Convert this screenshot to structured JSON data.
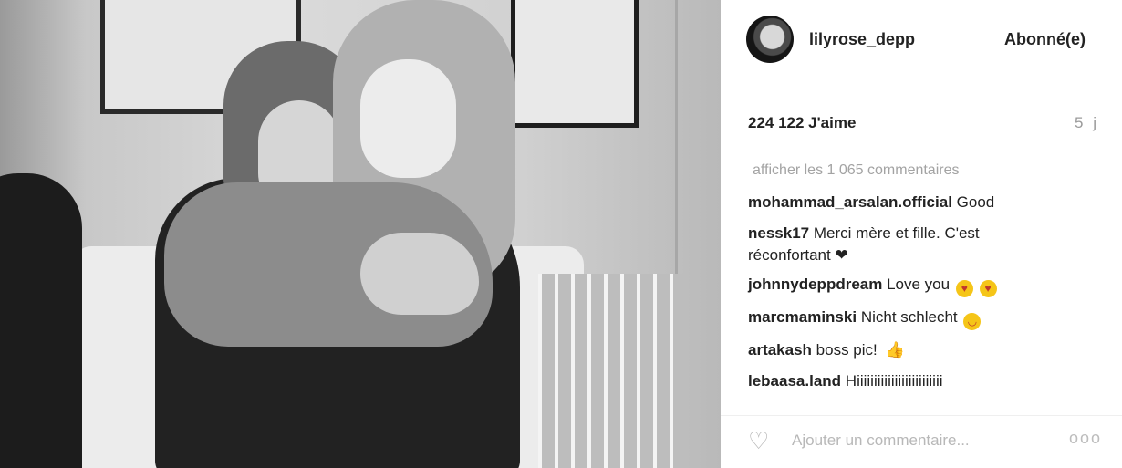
{
  "post": {
    "username": "lilyrose_depp",
    "follow_label": "Abonné(e)",
    "likes": "224 122 J'aime",
    "time": "5 j",
    "view_all_comments": "afficher les 1 065 commentaires",
    "comments": [
      {
        "author": "mohammad_arsalan.official",
        "text": "Good"
      },
      {
        "author": "nessk17",
        "text": "Merci mère et fille. C'est réconfortant ❤"
      },
      {
        "author": "johnnydeppdream",
        "text": "Love you",
        "emoji": "heart-eyes-emoji x2"
      },
      {
        "author": "marcmaminski",
        "text": "Nicht schlecht",
        "emoji": "smile-emoji"
      },
      {
        "author": "artakash",
        "text": "boss pic!",
        "emoji": "thumbs-up-emoji"
      },
      {
        "author": "lebaasa.land",
        "text": "Hiiiiiiiiiiiiiiiiiiiiiiiii"
      }
    ],
    "add_comment_placeholder": "Ajouter un commentaire...",
    "more_label": "ooo"
  },
  "icons": {
    "heart": "heart-icon",
    "more": "more-options-icon",
    "avatar": "profile-avatar"
  },
  "colors": {
    "text_primary": "#222222",
    "text_muted": "#a3a3a3",
    "background": "#ffffff"
  }
}
